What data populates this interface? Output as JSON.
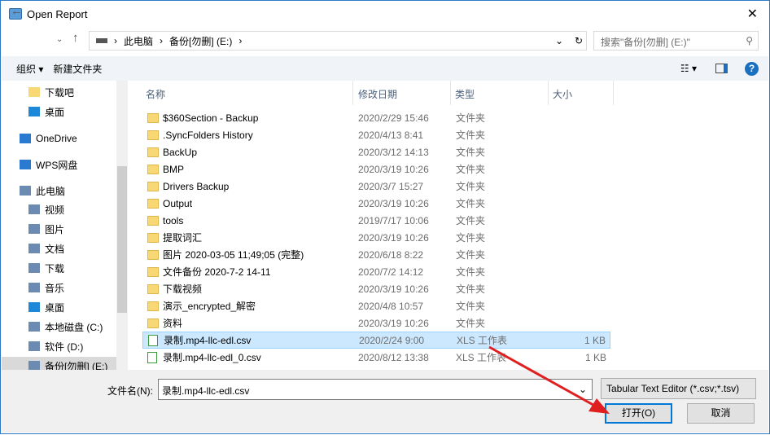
{
  "title": "Open Report",
  "address": {
    "crumbs": [
      "此电脑",
      "备份[勿删] (E:)"
    ]
  },
  "search": {
    "placeholder": "搜索\"备份[勿删] (E:)\""
  },
  "toolbar": {
    "organize": "组织 ▾",
    "new_folder": "新建文件夹"
  },
  "sidebar": [
    "下载吧",
    "桌面",
    "OneDrive",
    "WPS网盘",
    "此电脑",
    "视频",
    "图片",
    "文档",
    "下载",
    "音乐",
    "桌面",
    "本地磁盘 (C:)",
    "软件 (D:)",
    "备份[勿删] (E:)"
  ],
  "columns": [
    "名称",
    "修改日期",
    "类型",
    "大小"
  ],
  "files": [
    {
      "name": "$360Section - Backup",
      "date": "2020/2/29 15:46",
      "type": "文件夹",
      "size": ""
    },
    {
      "name": ".SyncFolders History",
      "date": "2020/4/13 8:41",
      "type": "文件夹",
      "size": ""
    },
    {
      "name": "BackUp",
      "date": "2020/3/12 14:13",
      "type": "文件夹",
      "size": ""
    },
    {
      "name": "BMP",
      "date": "2020/3/19 10:26",
      "type": "文件夹",
      "size": ""
    },
    {
      "name": "Drivers Backup",
      "date": "2020/3/7 15:27",
      "type": "文件夹",
      "size": ""
    },
    {
      "name": "Output",
      "date": "2020/3/19 10:26",
      "type": "文件夹",
      "size": ""
    },
    {
      "name": "tools",
      "date": "2019/7/17 10:06",
      "type": "文件夹",
      "size": ""
    },
    {
      "name": "提取词汇",
      "date": "2020/3/19 10:26",
      "type": "文件夹",
      "size": ""
    },
    {
      "name": "图片 2020-03-05 11;49;05 (完整)",
      "date": "2020/6/18 8:22",
      "type": "文件夹",
      "size": ""
    },
    {
      "name": "文件备份 2020-7-2 14-11",
      "date": "2020/7/2 14:12",
      "type": "文件夹",
      "size": ""
    },
    {
      "name": "下载视频",
      "date": "2020/3/19 10:26",
      "type": "文件夹",
      "size": ""
    },
    {
      "name": "演示_encrypted_解密",
      "date": "2020/4/8 10:57",
      "type": "文件夹",
      "size": ""
    },
    {
      "name": "资料",
      "date": "2020/3/19 10:26",
      "type": "文件夹",
      "size": ""
    },
    {
      "name": "录制.mp4-llc-edl.csv",
      "date": "2020/2/24 9:00",
      "type": "XLS 工作表",
      "size": "1 KB"
    },
    {
      "name": "录制.mp4-llc-edl_0.csv",
      "date": "2020/8/12 13:38",
      "type": "XLS 工作表",
      "size": "1 KB"
    }
  ],
  "filename_label": "文件名(N):",
  "filename": "录制.mp4-llc-edl.csv",
  "filetype": "Tabular Text Editor (*.csv;*.tsv)",
  "open": "打开(O)",
  "cancel": "取消"
}
